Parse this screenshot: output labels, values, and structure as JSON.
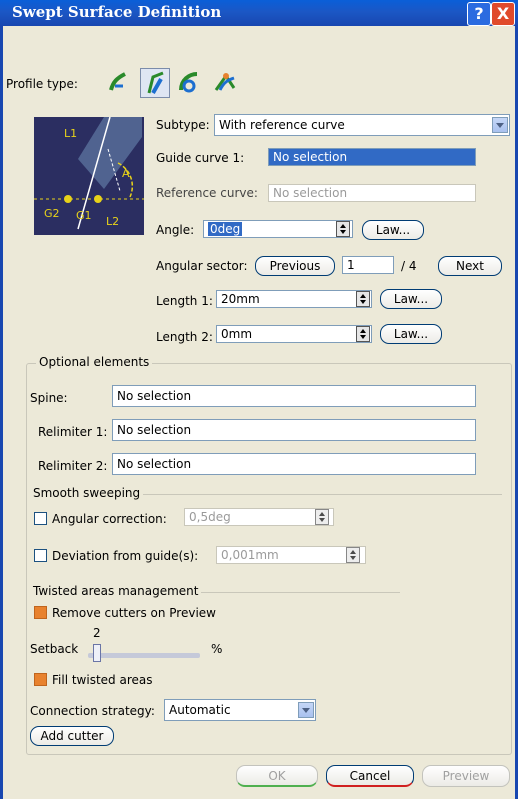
{
  "window": {
    "title": "Swept Surface Definition",
    "help_label": "?",
    "close_label": "X"
  },
  "profile_type": {
    "label": "Profile type:",
    "icons": [
      "explicit-profile-icon",
      "line-profile-icon",
      "circle-profile-icon",
      "conic-profile-icon"
    ],
    "active_index": 1
  },
  "preview": {
    "labels": {
      "l1": "L1",
      "a": "A",
      "g2": "G2",
      "g1": "G1",
      "l2": "L2"
    }
  },
  "subtype": {
    "label": "Subtype:",
    "value": "With reference curve"
  },
  "guide_curve_1": {
    "label": "Guide curve 1:",
    "value": "No selection"
  },
  "reference_curve": {
    "label": "Reference curve:",
    "value": "No selection"
  },
  "angle": {
    "label": "Angle:",
    "value": "0deg",
    "law_label": "Law..."
  },
  "angular_sector": {
    "label": "Angular sector:",
    "previous_label": "Previous",
    "value": "1",
    "total": "/ 4",
    "next_label": "Next"
  },
  "length1": {
    "label": "Length 1:",
    "value": "20mm",
    "law_label": "Law..."
  },
  "length2": {
    "label": "Length 2:",
    "value": "0mm",
    "law_label": "Law..."
  },
  "optional": {
    "title": "Optional elements",
    "spine": {
      "label": "Spine:",
      "value": "No selection"
    },
    "relimiter1": {
      "label": "Relimiter 1:",
      "value": "No selection"
    },
    "relimiter2": {
      "label": "Relimiter 2:",
      "value": "No selection"
    }
  },
  "smooth": {
    "title": "Smooth sweeping",
    "angular_correction": {
      "label": "Angular correction:",
      "value": "0,5deg",
      "checked": false
    },
    "deviation": {
      "label": "Deviation from guide(s):",
      "value": "0,001mm",
      "checked": false
    }
  },
  "twisted": {
    "title": "Twisted areas management",
    "remove_cutters": {
      "label": "Remove cutters on Preview",
      "checked": true
    },
    "setback": {
      "label": "Setback",
      "value": "2",
      "unit": "%"
    },
    "fill": {
      "label": "Fill twisted areas",
      "checked": true
    },
    "connection": {
      "label": "Connection strategy:",
      "value": "Automatic"
    },
    "add_cutter_label": "Add cutter"
  },
  "footer": {
    "ok_label": "OK",
    "cancel_label": "Cancel",
    "preview_label": "Preview"
  },
  "colors": {
    "title_bar": "#1b57c5",
    "dialog_bg": "#ece9d8",
    "selection": "#316ac5",
    "preview_bg": "#2b2e61",
    "checkbox_on": "#e8822e"
  }
}
